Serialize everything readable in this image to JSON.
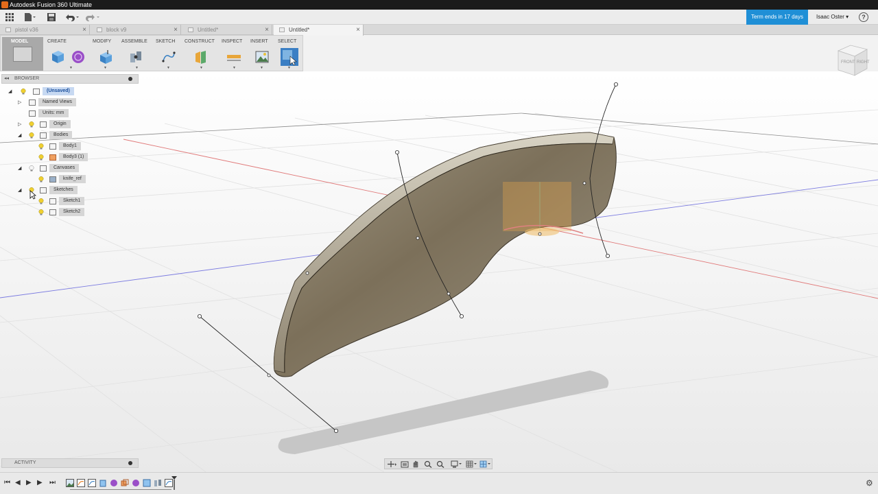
{
  "window": {
    "title": "Autodesk Fusion 360 Ultimate"
  },
  "toolbar": {
    "term_label": "Term ends in 17 days",
    "user_name": "Isaac Oster",
    "help_label": "?"
  },
  "tabs": [
    {
      "label": "pistol v36",
      "active": false
    },
    {
      "label": "block v9",
      "active": false
    },
    {
      "label": "Untitled*",
      "active": false
    },
    {
      "label": "Untitled*",
      "active": true
    }
  ],
  "ribbon": {
    "mode": "MODEL",
    "groups": [
      "CREATE",
      "MODIFY",
      "ASSEMBLE",
      "SKETCH",
      "CONSTRUCT",
      "INSPECT",
      "INSERT",
      "SELECT"
    ]
  },
  "viewcube": {
    "front": "FRONT",
    "right": "RIGHT"
  },
  "browser": {
    "title": "BROWSER",
    "items": [
      {
        "label": "(Unsaved)"
      },
      {
        "label": "Named Views"
      },
      {
        "label": "Units: mm"
      },
      {
        "label": "Origin"
      },
      {
        "label": "Bodies"
      },
      {
        "label": "Body1"
      },
      {
        "label": "Body3 (1)"
      },
      {
        "label": "Canvases"
      },
      {
        "label": "knife_ref"
      },
      {
        "label": "Sketches"
      },
      {
        "label": "Sketch1"
      },
      {
        "label": "Sketch2"
      }
    ]
  },
  "activity": {
    "title": "ACTIVITY"
  },
  "colors": {
    "accent": "#1f8fd6",
    "body": "#8a7d66",
    "x_axis": "#e06060",
    "z_axis": "#6a6ae0",
    "selection": "#c7d9f2"
  }
}
